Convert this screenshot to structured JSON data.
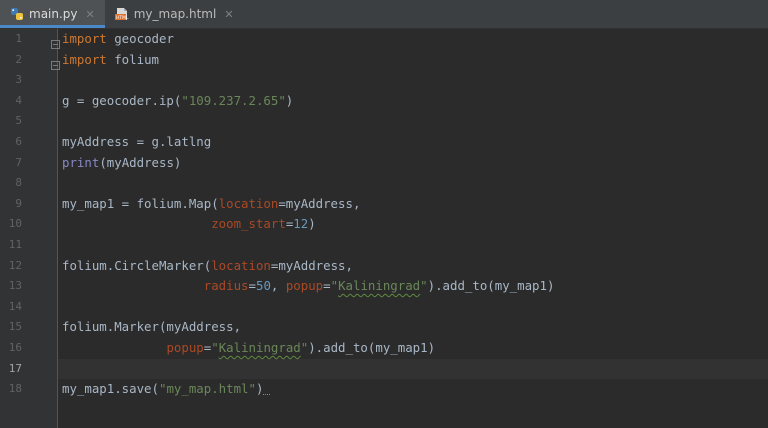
{
  "tabs": [
    {
      "label": "main.py",
      "icon": "python-file-icon",
      "active": true
    },
    {
      "label": "my_map.html",
      "icon": "html-file-icon",
      "active": false
    }
  ],
  "gutter": {
    "line_numbers": [
      "1",
      "2",
      "3",
      "4",
      "5",
      "6",
      "7",
      "8",
      "9",
      "10",
      "11",
      "12",
      "13",
      "14",
      "15",
      "16",
      "17",
      "18"
    ],
    "current_line": "17"
  },
  "code": {
    "line1": {
      "kw": "import",
      "rest": " geocoder"
    },
    "line2": {
      "kw": "import",
      "rest": " folium"
    },
    "line4": {
      "a": "g = geocoder.ip(",
      "s": "\"109.237.2.65\"",
      "b": ")"
    },
    "line6": {
      "a": "myAddress = g.latlng"
    },
    "line7": {
      "fn": "print",
      "a": "(myAddress)"
    },
    "line9": {
      "a": "my_map1 = folium.Map(",
      "p": "location",
      "b": "=myAddress,"
    },
    "line10": {
      "indent": "                    ",
      "p": "zoom_start",
      "b": "=",
      "n": "12",
      "c": ")"
    },
    "line12": {
      "a": "folium.CircleMarker(",
      "p": "location",
      "b": "=myAddress,"
    },
    "line13": {
      "indent": "                   ",
      "p1": "radius",
      "eq1": "=",
      "n": "50",
      "sep": ", ",
      "p2": "popup",
      "eq2": "=",
      "s1": "\"",
      "s2": "Kaliningrad",
      "s3": "\"",
      "c": ").add_to(my_map1)"
    },
    "line15": {
      "a": "folium.Marker(myAddress,"
    },
    "line16": {
      "indent": "              ",
      "p": "popup",
      "eq": "=",
      "s1": "\"",
      "s2": "Kaliningrad",
      "s3": "\"",
      "c": ").add_to(my_map1)"
    },
    "line18": {
      "a": "my_map1.save(",
      "s": "\"my_map.html\"",
      "b": ")"
    }
  }
}
